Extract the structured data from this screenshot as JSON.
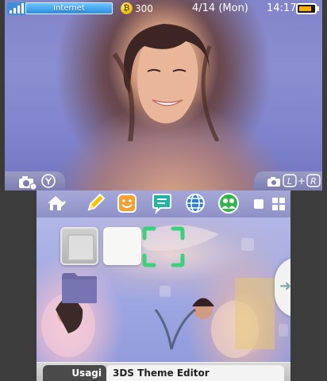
{
  "status_bar": {
    "wifi_label": "Internet",
    "coin_symbol": "₿",
    "play_coins": "300",
    "date": "4/14 (Mon)",
    "time": "14:17",
    "battery_level": 0.85
  },
  "top_screen": {
    "left_tab_icons": [
      "camera-icon",
      "y-button-icon"
    ],
    "right_tab_icons": [
      "camera-icon",
      "l-plus-r-icon"
    ]
  },
  "bottom_screen": {
    "topbar_icons": [
      "home-settings-icon",
      "pencil-icon",
      "smiley-icon",
      "speech-bubble-icon",
      "globe-icon",
      "friends-icon",
      "grid-small-icon",
      "grid-large-icon"
    ],
    "scroll_arrow": "➜"
  },
  "watermark": {
    "user": "Usagi",
    "app": "3DS Theme Editor"
  },
  "colors": {
    "wifi": "#2a8fe0",
    "battery": "#ffae00",
    "pencil": "#f5c400",
    "smiley": "#f3a230",
    "chat": "#23b5a3",
    "globe": "#2c7ad6",
    "friends": "#33b34a",
    "cursor": "#3bcf7e"
  }
}
